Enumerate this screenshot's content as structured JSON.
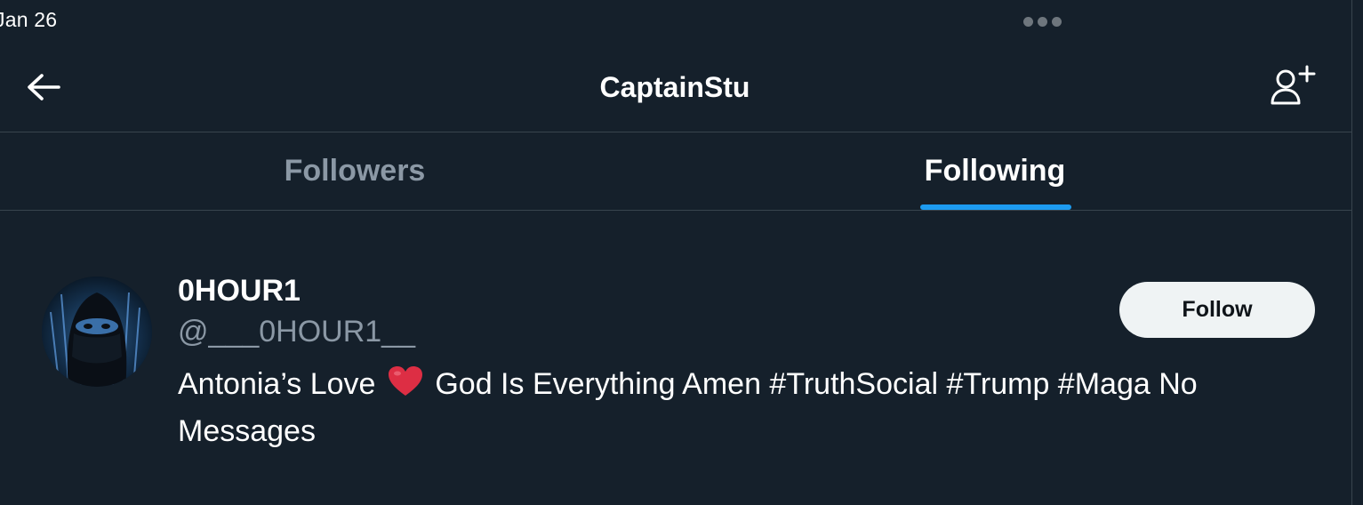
{
  "status_bar": {
    "date": "Jan 26"
  },
  "header": {
    "title": "CaptainStu",
    "back_icon": "arrow-left-icon",
    "add_user_icon": "person-add-icon"
  },
  "tabs": [
    {
      "label": "Followers",
      "active": false
    },
    {
      "label": "Following",
      "active": true
    }
  ],
  "users": [
    {
      "display_name": "0HOUR1",
      "username": "@___0HOUR1__",
      "bio_before_heart": "Antonia’s Love",
      "bio_after_heart": "God Is Everything Amen #TruthSocial #Trump #Maga No Messages",
      "follow_label": "Follow"
    }
  ],
  "colors": {
    "background": "#15202b",
    "accent": "#1d9bf0",
    "divider": "#38444d",
    "secondary_text": "#8b98a5",
    "follow_button_bg": "#eff3f4"
  }
}
